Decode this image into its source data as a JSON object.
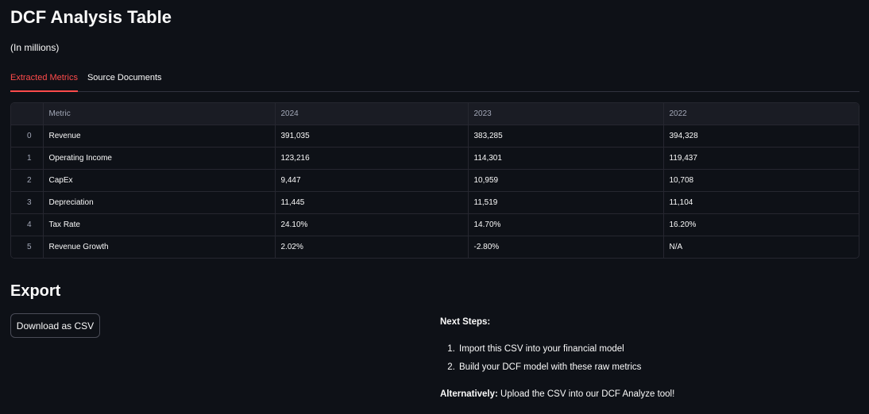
{
  "header": {
    "title": "DCF Analysis Table",
    "subtitle": "(In millions)"
  },
  "tabs": [
    {
      "label": "Extracted Metrics",
      "active": true
    },
    {
      "label": "Source Documents",
      "active": false
    }
  ],
  "table": {
    "columns": [
      "",
      "Metric",
      "2024",
      "2023",
      "2022"
    ],
    "rows": [
      [
        "0",
        "Revenue",
        "391,035",
        "383,285",
        "394,328"
      ],
      [
        "1",
        "Operating Income",
        "123,216",
        "114,301",
        "119,437"
      ],
      [
        "2",
        "CapEx",
        "9,447",
        "10,959",
        "10,708"
      ],
      [
        "3",
        "Depreciation",
        "11,445",
        "11,519",
        "11,104"
      ],
      [
        "4",
        "Tax Rate",
        "24.10%",
        "14.70%",
        "16.20%"
      ],
      [
        "5",
        "Revenue Growth",
        "2.02%",
        "-2.80%",
        "N/A"
      ]
    ]
  },
  "export": {
    "title": "Export",
    "download_label": "Download as CSV"
  },
  "next_steps": {
    "heading": "Next Steps:",
    "items": [
      "Import this CSV into your financial model",
      "Build your DCF model with these raw metrics"
    ],
    "alt_prefix": "Alternatively:",
    "alt_text": " Upload the CSV into our DCF Analyze tool!"
  },
  "colors": {
    "background": "#0e1117",
    "accent": "#ff4b4b",
    "header_bg": "#1a1c24",
    "border": "#262730"
  }
}
